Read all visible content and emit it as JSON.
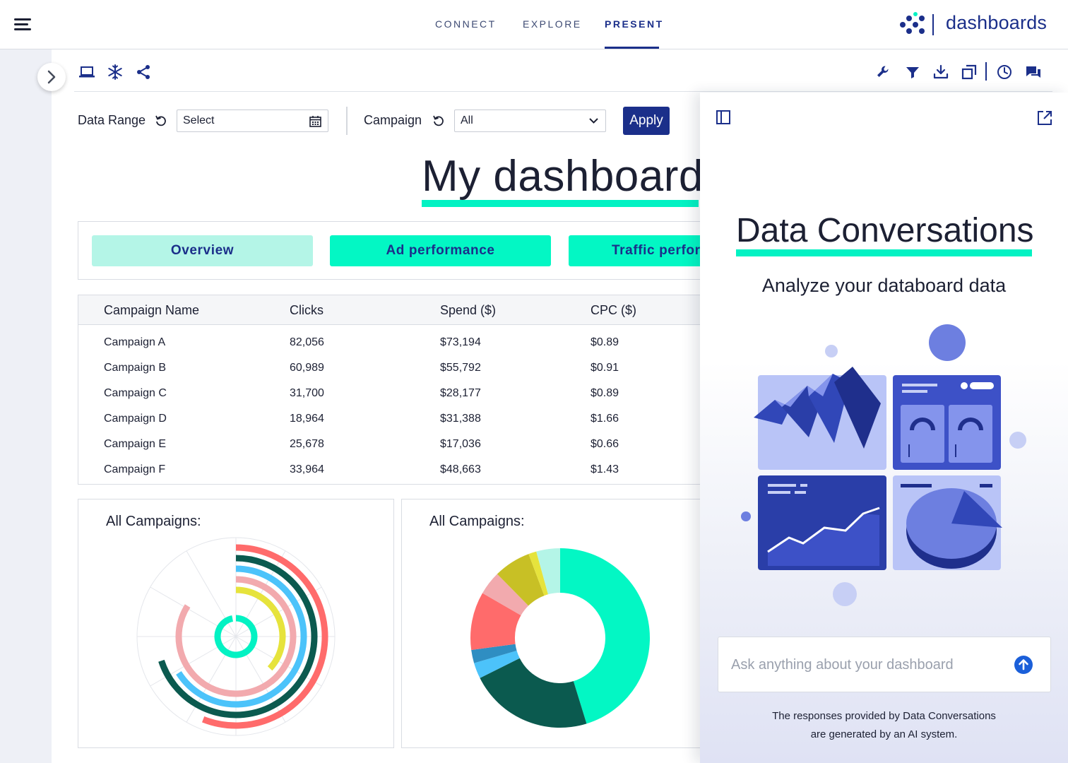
{
  "brand": {
    "name": "dashboards",
    "color": "#1b2f8a",
    "accent": "#03f2c3"
  },
  "nav": {
    "items": [
      {
        "label": "CONNECT"
      },
      {
        "label": "EXPLORE"
      },
      {
        "label": "PRESENT",
        "active": true
      }
    ]
  },
  "toolbar": {
    "left_icons": [
      "laptop-icon",
      "snowflake-icon",
      "share-icon"
    ],
    "right_icons": [
      "wrench-icon",
      "filter-icon",
      "download-icon",
      "duplicate-icon",
      "clock-icon",
      "chat-icon"
    ]
  },
  "filters": {
    "data_range": {
      "label": "Data Range",
      "value": "Select"
    },
    "campaign": {
      "label": "Campaign",
      "value": "All"
    },
    "apply_label": "Apply"
  },
  "dashboard": {
    "title": "My dashboard",
    "tabs": [
      {
        "label": "Overview",
        "selected": true
      },
      {
        "label": "Ad performance"
      },
      {
        "label": "Traffic perfor"
      }
    ]
  },
  "table": {
    "columns": [
      "Campaign Name",
      "Clicks",
      "Spend ($)",
      "CPC ($)"
    ],
    "rows": [
      [
        "Campaign A",
        "82,056",
        "$73,194",
        "$0.89"
      ],
      [
        "Campaign B",
        "60,989",
        "$55,792",
        "$0.91"
      ],
      [
        "Campaign C",
        "31,700",
        "$28,177",
        "$0.89"
      ],
      [
        "Campaign D",
        "18,964",
        "$31,388",
        "$1.66"
      ],
      [
        "Campaign E",
        "25,678",
        "$17,036",
        "$0.66"
      ],
      [
        "Campaign F",
        "33,964",
        "$48,663",
        "$1.43"
      ]
    ]
  },
  "chart_data": [
    {
      "type": "radial-bar",
      "title": "All Campaigns:",
      "series": [
        {
          "color": "#ff6b6b",
          "value": 0.56
        },
        {
          "color": "#0b5a4f",
          "value": 0.7
        },
        {
          "color": "#4cc3fa",
          "value": 0.66
        },
        {
          "color": "#f2aaae",
          "value": 0.84
        },
        {
          "color": "#e6e33c",
          "value": 0.37
        },
        {
          "color": "#03f2c3",
          "value": 0.97
        }
      ]
    },
    {
      "type": "pie",
      "title": "All Campaigns:",
      "slices": [
        {
          "color": "#03f7c4",
          "value": 47.5
        },
        {
          "color": "#0b5a4f",
          "value": 23.5
        },
        {
          "color": "#4cc3fa",
          "value": 3.0
        },
        {
          "color": "#2f8ec2",
          "value": 2.5
        },
        {
          "color": "#ff6b6b",
          "value": 11.0
        },
        {
          "color": "#f2aaae",
          "value": 4.5
        },
        {
          "color": "#c8c025",
          "value": 7.0
        },
        {
          "color": "#e6e33c",
          "value": 1.5
        },
        {
          "color": "#b4f5e7",
          "value": 4.5
        }
      ]
    }
  ],
  "panel": {
    "title": "Data Conversations",
    "subtitle": "Analyze your databoard data",
    "ask_placeholder": "Ask anything about your dashboard",
    "disclaimer_line1": "The responses provided by Data Conversations",
    "disclaimer_line2": "are generated by an AI system."
  }
}
